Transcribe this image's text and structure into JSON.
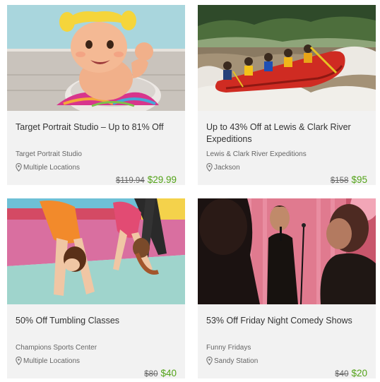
{
  "deals": [
    {
      "title": "Target Portrait Studio – Up to 81% Off",
      "merchant": "Target Portrait Studio",
      "location": "Multiple Locations",
      "original_price": "$119.94",
      "price": "$29.99"
    },
    {
      "title": "Up to 43% Off at Lewis & Clark River Expeditions",
      "merchant": "Lewis & Clark River Expeditions",
      "location": "Jackson",
      "original_price": "$158",
      "price": "$95"
    },
    {
      "title": "50% Off Tumbling Classes",
      "merchant": "Champions Sports Center",
      "location": "Multiple Locations",
      "original_price": "$80",
      "price": "$40"
    },
    {
      "title": "53% Off Friday Night Comedy Shows",
      "merchant": "Funny Fridays",
      "location": "Sandy Station",
      "original_price": "$40",
      "price": "$20"
    }
  ],
  "colors": {
    "card_bg": "#f2f2f2",
    "price": "#53a318",
    "text": "#333333",
    "muted": "#666666"
  },
  "icons": {
    "location": "map-pin-icon"
  }
}
